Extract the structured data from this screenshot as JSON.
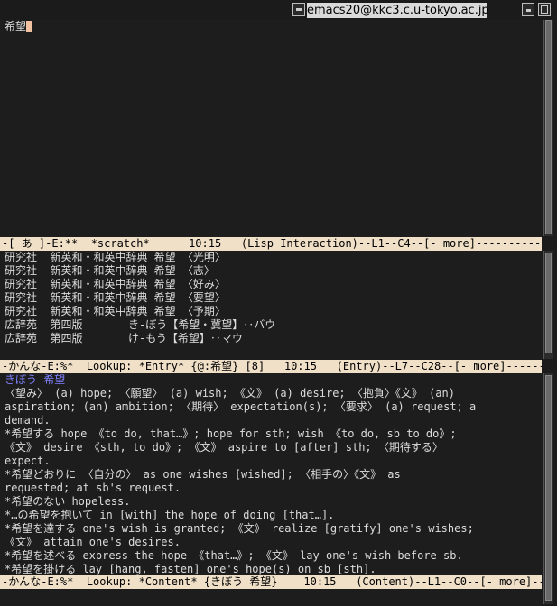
{
  "window": {
    "title": "emacs20@kkc3.c.u-tokyo.ac.jp"
  },
  "scratch": {
    "text": "希望",
    "modeline": "-[ あ ]-E:**  *scratch*      10:15   (Lisp Interaction)--L1--C4--[- more]------------"
  },
  "entry": {
    "lines": [
      "研究社  新英和・和英中辞典 希望 〈光明〉",
      "研究社  新英和・和英中辞典 希望 〈志〉",
      "研究社  新英和・和英中辞典 希望 〈好み〉",
      "研究社  新英和・和英中辞典 希望 〈要望〉",
      "研究社  新英和・和英中辞典 希望 〈予期〉",
      "広辞苑  第四版       き-ぼう【希望・冀望】‥バウ",
      "広辞苑  第四版       け-もう【希望】‥マウ"
    ],
    "modeline": "-かんな-E:%*  Lookup: *Entry* {@:希望} [8]   10:15   (Entry)--L7--C28--[- more]------"
  },
  "content": {
    "heading": "きぼう 希望",
    "lines": [
      "〈望み〉 (a) hope; 〈願望〉 (a) wish; 《文》 (a) desire; 〈抱負〉《文》 (an)",
      "aspiration; (an) ambition; 〈期待〉 expectation(s); 〈要求〉 (a) request; a",
      "demand.",
      "*希望する hope 《to do, that…》; hope for sth; wish 《to do, sb to do》;",
      "《文》 desire 《sth, to do》; 《文》 aspire to [after] sth; 〈期待する〉",
      "expect.",
      "*希望どおりに 〈自分の〉 as one wishes [wished]; 〈相手の〉《文》 as",
      "requested; at sb's request.",
      "*希望のない hopeless.",
      "*…の希望を抱いて in [with] the hope of doing [that…].",
      "*希望を達する one's wish is granted; 《文》 realize [gratify] one's wishes;",
      "《文》 attain one's desires.",
      "*希望を述べる express the hope 《that…》; 《文》 lay one's wish before sb.",
      "*希望を掛ける lay [hang, fasten] one's hope(s) on sb [sth]."
    ],
    "modeline": "-かんな-E:%*  Lookup: *Content* {きぼう 希望}    10:15   (Content)--L1--C0--[- more]----"
  },
  "icons": {
    "window_menu": "window-menu-icon",
    "minimize": "minimize-icon",
    "maximize": "maximize-icon"
  }
}
